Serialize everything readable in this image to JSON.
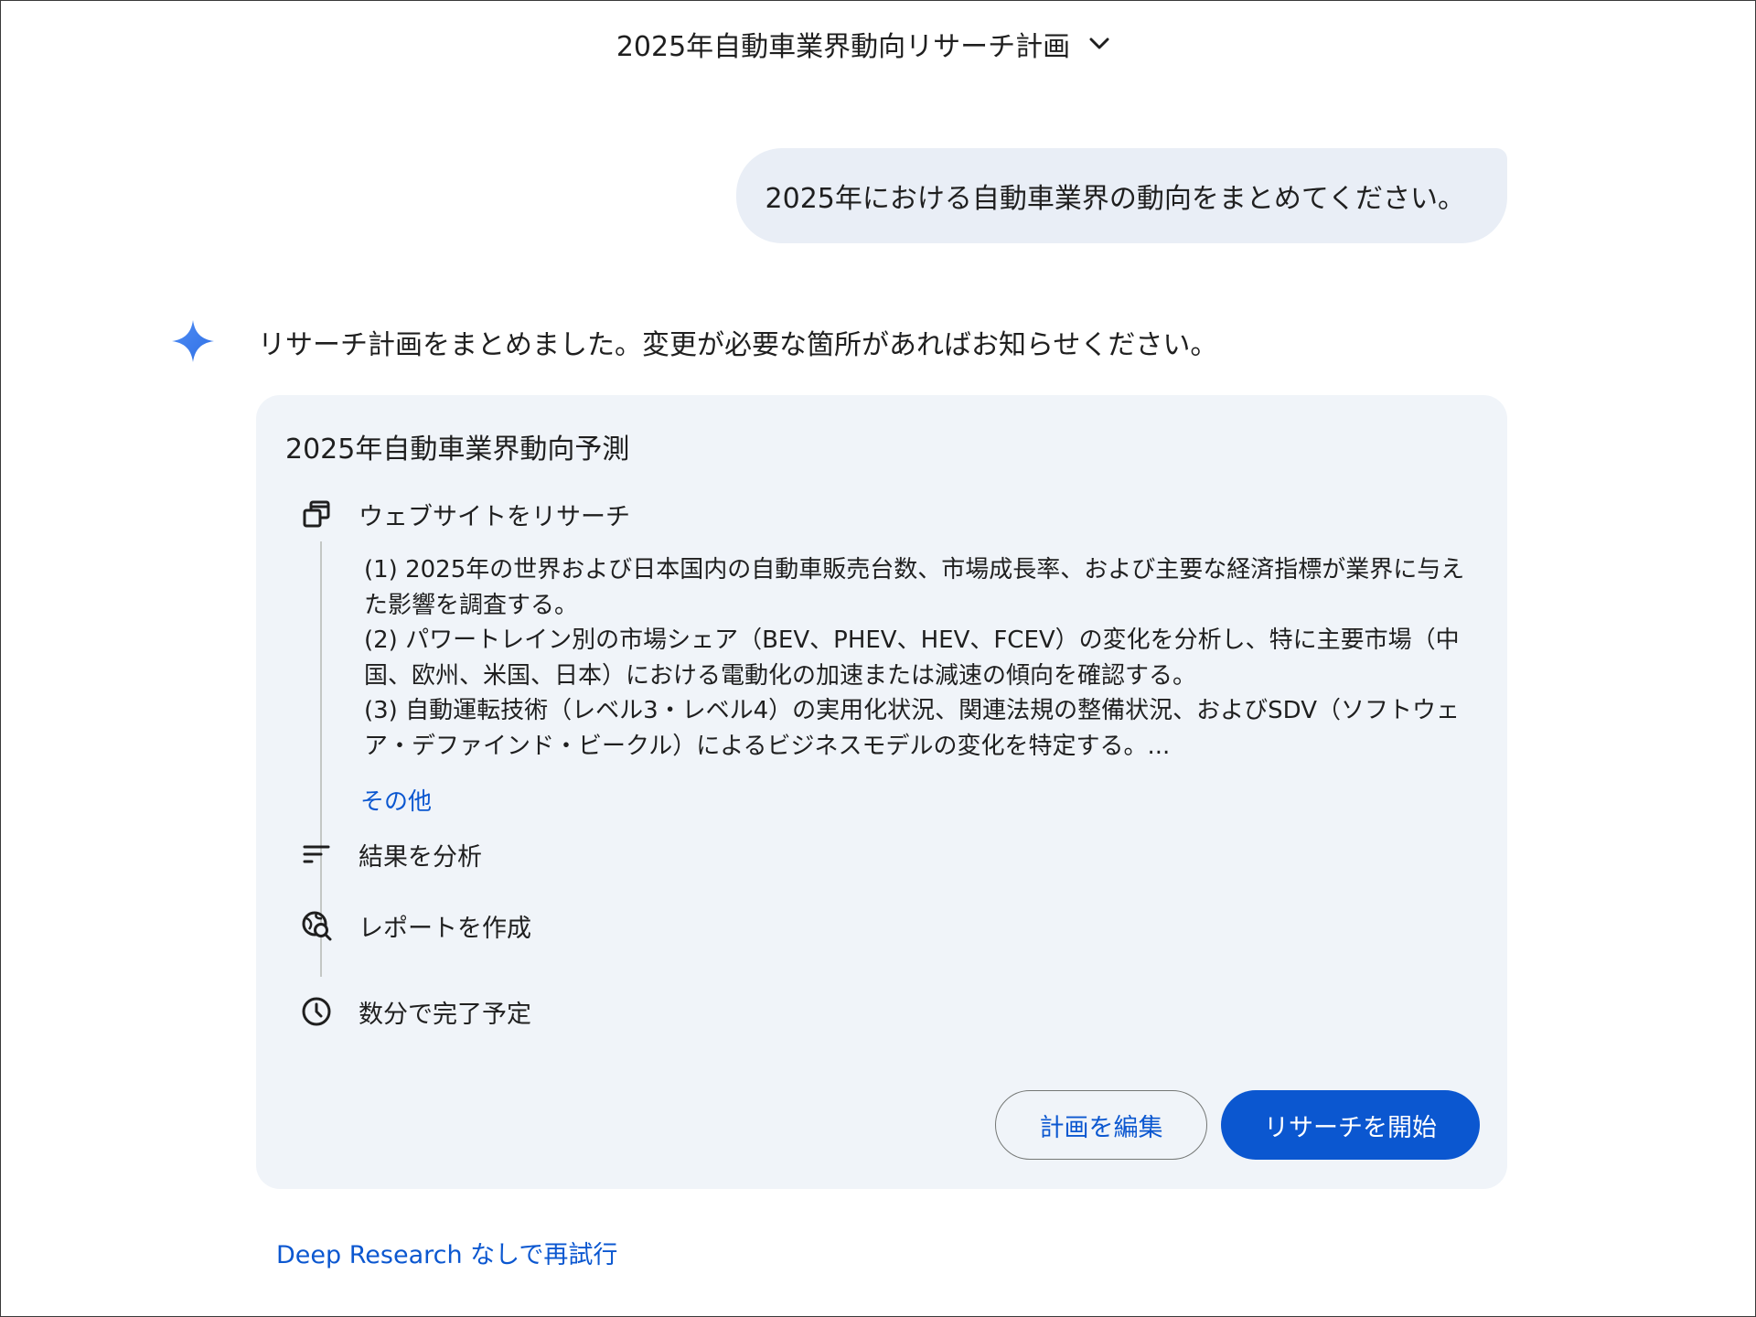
{
  "header": {
    "title": "2025年自動車業界動向リサーチ計画"
  },
  "user_message": "2025年における自動車業界の動向をまとめてください。",
  "response": {
    "text": "リサーチ計画をまとめました。変更が必要な箇所があればお知らせください。"
  },
  "plan": {
    "title": "2025年自動車業界動向予測",
    "steps": [
      {
        "label": "ウェブサイトをリサーチ",
        "icon": "browser-windows-icon"
      },
      {
        "label": "結果を分析",
        "icon": "sort-lines-icon"
      },
      {
        "label": "レポートを作成",
        "icon": "globe-search-icon"
      },
      {
        "label": "数分で完了予定",
        "icon": "clock-icon"
      }
    ],
    "details": [
      "(1) 2025年の世界および日本国内の自動車販売台数、市場成長率、および主要な経済指標が業界に与えた影響を調査する。",
      "(2) パワートレイン別の市場シェア（BEV、PHEV、HEV、FCEV）の変化を分析し、特に主要市場（中国、欧州、米国、日本）における電動化の加速または減速の傾向を確認する。",
      "(3) 自動運転技術（レベル3・レベル4）の実用化状況、関連法規の整備状況、およびSDV（ソフトウェア・デファインド・ビークル）によるビジネスモデルの変化を特定する。..."
    ],
    "more_link": "その他",
    "edit_button": "計画を編集",
    "start_button": "リサーチを開始"
  },
  "retry_link": "Deep Research なしで再試行",
  "colors": {
    "accent": "#0b57d0",
    "card_bg": "#f0f4f9",
    "bubble_bg": "#e9eef6",
    "spark_from": "#4285f4",
    "spark_to": "#9bbcf8"
  }
}
